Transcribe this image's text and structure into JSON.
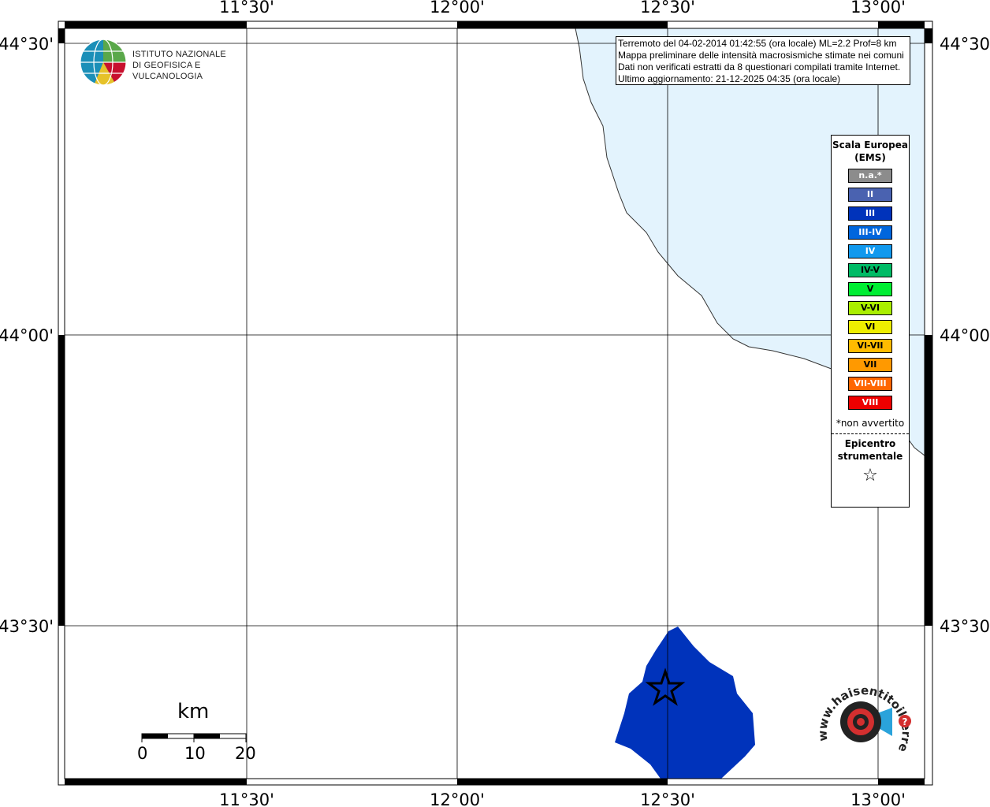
{
  "map": {
    "lon_ticks_top": [
      "11°30'",
      "12°00'",
      "12°30'",
      "13°00'"
    ],
    "lon_ticks_bottom": [
      "11°30'",
      "12°00'",
      "12°30'",
      "13°00'"
    ],
    "lat_ticks_left": [
      "44°30'",
      "44°00'",
      "43°30'"
    ],
    "lat_ticks_right": [
      "44°30'",
      "44°00'",
      "43°30'"
    ],
    "sea_color": "#e3f3fd",
    "intensity_area_color": "#0033bb",
    "intensity_class": "III"
  },
  "info_box": {
    "line1": "Terremoto del 04-02-2014 01:42:55 (ora locale) ML=2.2 Prof=8 km",
    "line2": "Mappa preliminare delle intensità macrosismiche stimate nei comuni",
    "line3": "Dati non verificati estratti da 8 questionari compilati tramite Internet.",
    "line4": "Ultimo aggiornamento: 21-12-2025 04:35 (ora locale)"
  },
  "logo": {
    "line1": "ISTITUTO NAZIONALE",
    "line2": "DI GEOFISICA E VULCANOLOGIA"
  },
  "legend": {
    "title": "Scala Europea (EMS)",
    "items": [
      {
        "label": "n.a.*",
        "color": "#8c8c8c"
      },
      {
        "label": "II",
        "color": "#4a62b0"
      },
      {
        "label": "III",
        "color": "#0033bb"
      },
      {
        "label": "III-IV",
        "color": "#0066dd"
      },
      {
        "label": "IV",
        "color": "#1199ee"
      },
      {
        "label": "IV-V",
        "color": "#00bb66"
      },
      {
        "label": "V",
        "color": "#00ee33"
      },
      {
        "label": "V-VI",
        "color": "#aaee00"
      },
      {
        "label": "VI",
        "color": "#eeee00"
      },
      {
        "label": "VI-VII",
        "color": "#ffbb00"
      },
      {
        "label": "VII",
        "color": "#ff9900"
      },
      {
        "label": "VII-VIII",
        "color": "#ff6600"
      },
      {
        "label": "VIII",
        "color": "#ee0000"
      }
    ],
    "note": "*non avvertito",
    "epicenter_title": "Epicentro strumentale",
    "epicenter_symbol": "☆"
  },
  "scale_bar": {
    "unit": "km",
    "ticks": [
      "0",
      "10",
      "20"
    ]
  },
  "haisentito_logo": {
    "text": "www.haisentitoilterremoto.it"
  }
}
